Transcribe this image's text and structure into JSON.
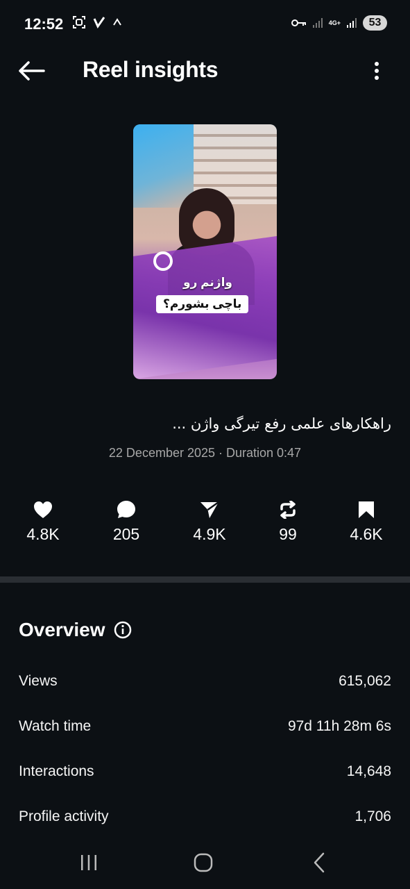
{
  "status_bar": {
    "time": "12:52",
    "network": "4G+",
    "battery": "53"
  },
  "header": {
    "title": "Reel insights"
  },
  "reel": {
    "overlay_line1": "واژنم رو",
    "overlay_line2": "باچی بشورم؟",
    "caption": "راهکارهای علمی رفع تیرگی واژن ...",
    "meta": "22 December 2025 · Duration 0:47"
  },
  "stats": {
    "likes": "4.8K",
    "comments": "205",
    "shares": "4.9K",
    "reposts": "99",
    "saves": "4.6K"
  },
  "overview": {
    "title": "Overview",
    "rows": [
      {
        "label": "Views",
        "value": "615,062"
      },
      {
        "label": "Watch time",
        "value": "97d 11h 28m 6s"
      },
      {
        "label": "Interactions",
        "value": "14,648"
      },
      {
        "label": "Profile activity",
        "value": "1,706"
      }
    ]
  },
  "icons": {
    "back": "arrow-left-icon",
    "more": "more-vertical-icon",
    "like": "heart-icon",
    "comment": "comment-icon",
    "share": "send-icon",
    "repost": "repost-icon",
    "save": "bookmark-icon",
    "info": "info-icon"
  }
}
